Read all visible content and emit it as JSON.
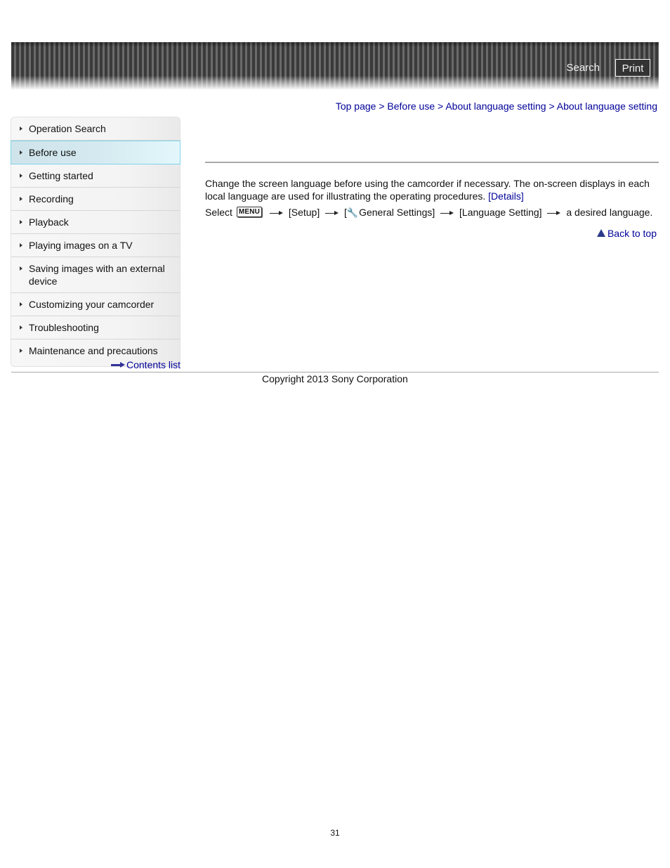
{
  "header": {
    "search_label": "Search",
    "print_label": "Print"
  },
  "breadcrumb": {
    "items": [
      "Top page",
      "Before use",
      "About language setting",
      "About language setting"
    ],
    "separator": ">"
  },
  "sidebar": {
    "items": [
      {
        "label": "Operation Search",
        "active": false
      },
      {
        "label": "Before use",
        "active": true
      },
      {
        "label": "Getting started",
        "active": false
      },
      {
        "label": "Recording",
        "active": false
      },
      {
        "label": "Playback",
        "active": false
      },
      {
        "label": "Playing images on a TV",
        "active": false
      },
      {
        "label": "Saving images with an external device",
        "active": false
      },
      {
        "label": "Customizing your camcorder",
        "active": false
      },
      {
        "label": "Troubleshooting",
        "active": false
      },
      {
        "label": "Maintenance and precautions",
        "active": false
      }
    ],
    "contents_link": "Contents list"
  },
  "main": {
    "intro": "Change the screen language before using the camcorder if necessary. The on-screen displays in each local language are used for illustrating the operating procedures.",
    "details_link": "[Details]",
    "step": {
      "select_label": "Select",
      "menu_key": "MENU",
      "setup": "[Setup]",
      "general_open": "[",
      "general_icon": "wrench-icon",
      "general_label": "General Settings]",
      "language_setting": "[Language Setting]",
      "final": "a desired language."
    },
    "back_to_top": "Back to top"
  },
  "footer": {
    "copyright": "Copyright 2013 Sony Corporation",
    "page_number": "31"
  },
  "colors": {
    "link": "#000099",
    "active_item_border": "#7fd3ea",
    "active_item_bg": "#d4eaf0"
  }
}
